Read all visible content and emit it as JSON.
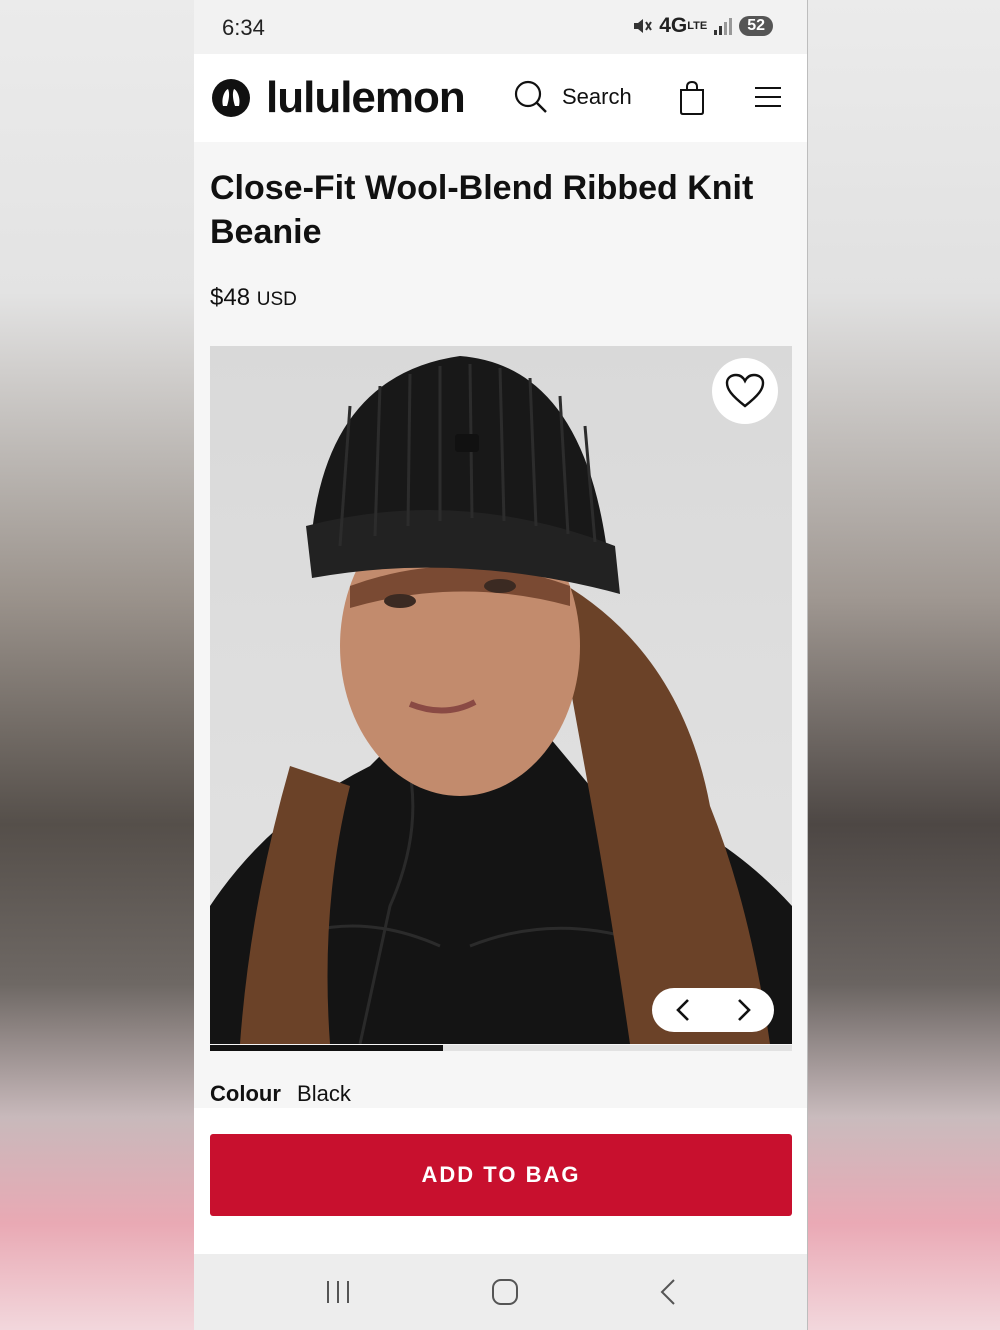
{
  "status_bar": {
    "time": "6:34",
    "network": "4G",
    "network_sub": "LTE",
    "battery": "52"
  },
  "header": {
    "brand": "lululemon",
    "search_label": "Search"
  },
  "product": {
    "title": "Close-Fit Wool-Blend Ribbed Knit Beanie",
    "price": "$48",
    "currency": "USD",
    "colour_label": "Colour",
    "colour_value": "Black",
    "image_progress": 0.4
  },
  "actions": {
    "add_to_bag": "ADD TO BAG"
  },
  "colors": {
    "accent": "#c8102e",
    "text": "#111111"
  },
  "icons": [
    "lululemon-logo-icon",
    "search-icon",
    "bag-icon",
    "menu-icon",
    "heart-icon",
    "chevron-left-icon",
    "chevron-right-icon",
    "recents-icon",
    "home-icon",
    "back-icon"
  ]
}
